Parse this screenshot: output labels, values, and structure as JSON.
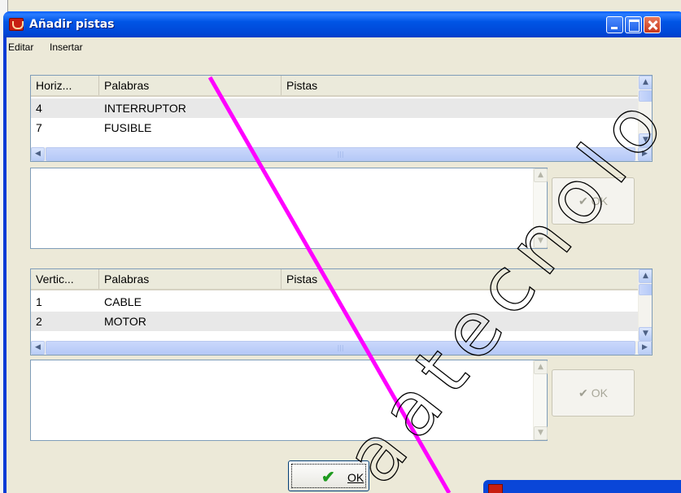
{
  "window": {
    "title": "Añadir pistas"
  },
  "menu": {
    "editar": "Editar",
    "insertar": "Insertar"
  },
  "horizontal_list": {
    "columns": [
      "Horiz...",
      "Palabras",
      "Pistas"
    ],
    "rows": [
      {
        "num": "4",
        "word": "INTERRUPTOR",
        "clue": ""
      },
      {
        "num": "7",
        "word": "FUSIBLE",
        "clue": ""
      }
    ]
  },
  "vertical_list": {
    "columns": [
      "Vertic...",
      "Palabras",
      "Pistas"
    ],
    "rows": [
      {
        "num": "1",
        "word": "CABLE",
        "clue": ""
      },
      {
        "num": "2",
        "word": "MOTOR",
        "clue": ""
      }
    ]
  },
  "buttons": {
    "ok_top": "OK",
    "ok_bottom": "OK",
    "ok_main": "OK"
  },
  "watermark": {
    "text": "aatecnolo"
  },
  "colors": {
    "titlebar": "#0055e5",
    "watermark_line": "#ff00ff",
    "ok_check": "#1e9a1e"
  }
}
